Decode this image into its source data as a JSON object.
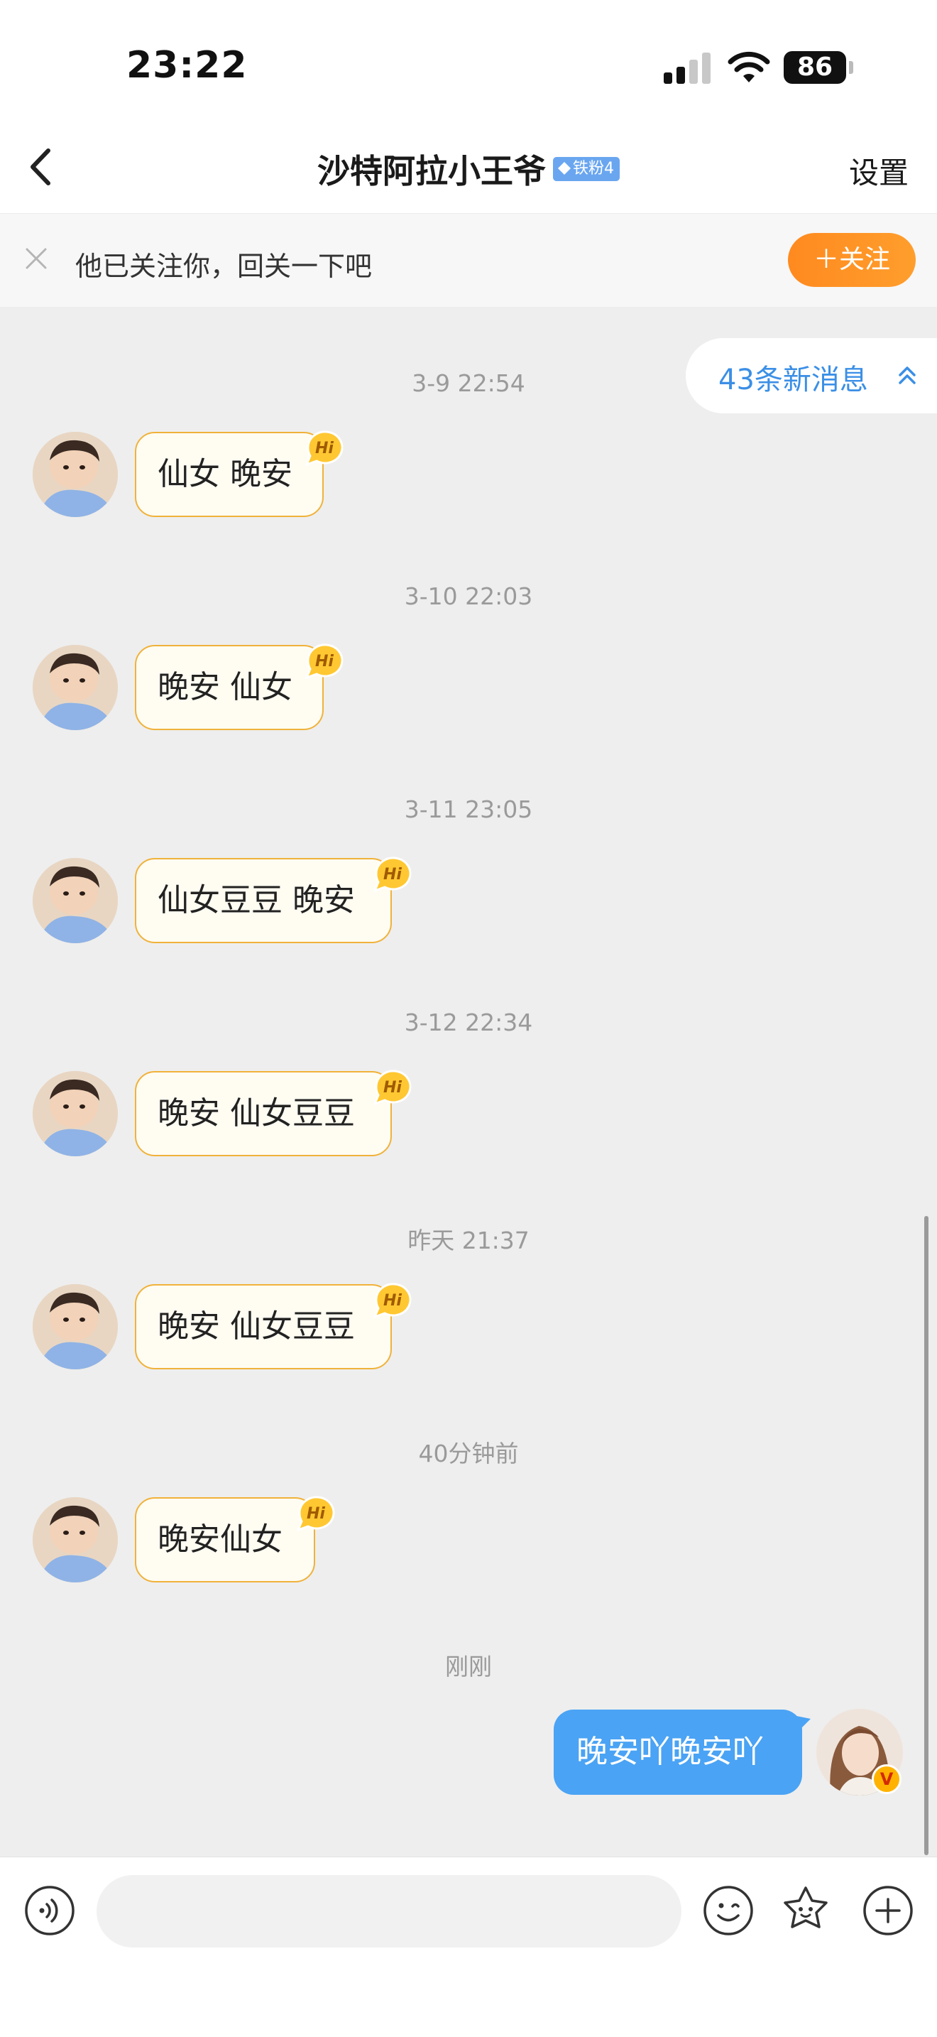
{
  "status_bar": {
    "time": "23:22",
    "battery": "86"
  },
  "header": {
    "title": "沙特阿拉小王爷",
    "fan_badge": "铁粉4",
    "settings_label": "设置"
  },
  "follow_bar": {
    "message": "他已关注你，回关一下吧",
    "follow_button": "＋关注"
  },
  "new_messages": {
    "label": "43条新消息"
  },
  "messages": [
    {
      "timestamp": "3-9 22:54",
      "sender": "other",
      "text": "仙女 晚安"
    },
    {
      "timestamp": "3-10 22:03",
      "sender": "other",
      "text": "晚安 仙女"
    },
    {
      "timestamp": "3-11 23:05",
      "sender": "other",
      "text": "仙女豆豆 晚安"
    },
    {
      "timestamp": "3-12 22:34",
      "sender": "other",
      "text": "晚安 仙女豆豆"
    },
    {
      "timestamp": "昨天 21:37",
      "sender": "other",
      "text": "晚安 仙女豆豆"
    },
    {
      "timestamp": "40分钟前",
      "sender": "other",
      "text": "晚安仙女"
    },
    {
      "timestamp": "刚刚",
      "sender": "me",
      "text": "晚安吖晚安吖"
    }
  ],
  "badges": {
    "hi": "Hi",
    "verified": "V"
  },
  "input": {
    "value": "",
    "placeholder": ""
  },
  "colors": {
    "accent_blue": "#4aa3f4",
    "follow_orange": "#ff8a1f",
    "bubble_border": "#f0b23a",
    "chat_bg": "#eeeeee"
  },
  "icons": {
    "back": "chevron-left-icon",
    "close": "close-icon",
    "voice": "voice-icon",
    "emoji": "emoji-icon",
    "sticker": "sticker-icon",
    "plus": "plus-icon",
    "collapse": "double-chevron-up-icon"
  }
}
